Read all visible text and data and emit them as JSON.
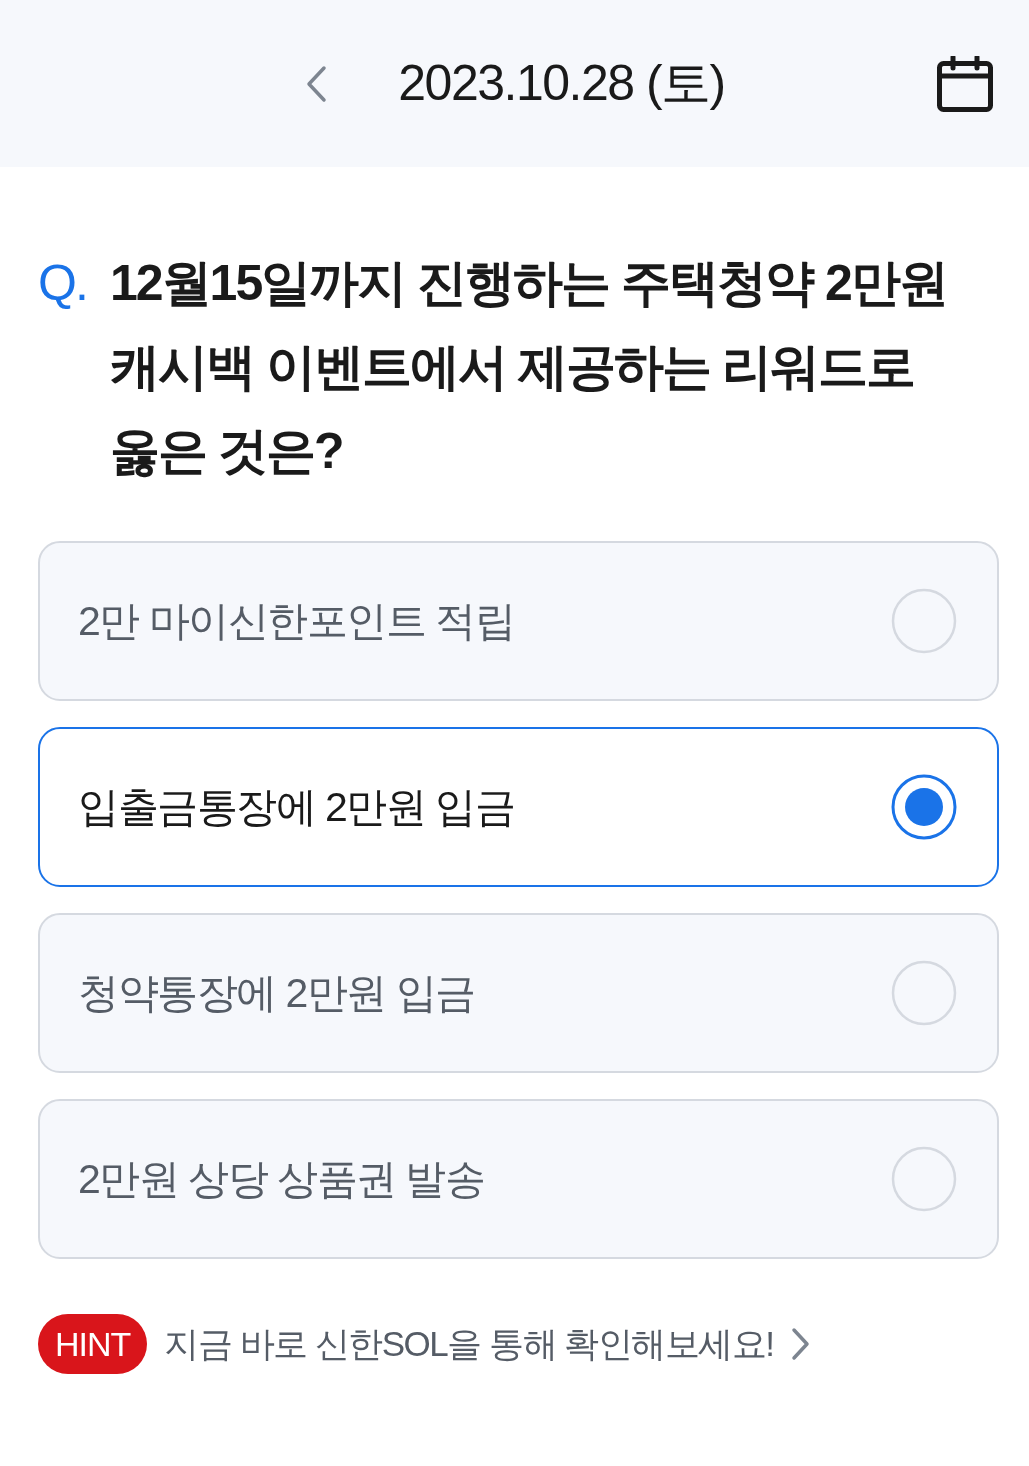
{
  "header": {
    "date": "2023.10.28 (토)"
  },
  "question": {
    "marker": "Q.",
    "text": "12월15일까지 진행하는 주택청약 2만원 캐시백 이벤트에서 제공하는 리워드로 옳은 것은?"
  },
  "options": [
    {
      "label": "2만 마이신한포인트 적립",
      "selected": false
    },
    {
      "label": "입출금통장에 2만원 입금",
      "selected": true
    },
    {
      "label": "청약통장에 2만원 입금",
      "selected": false
    },
    {
      "label": "2만원 상당 상품권 발송",
      "selected": false
    }
  ],
  "hint": {
    "badge": "HINT",
    "text": "지금 바로 신한SOL을 통해 확인해보세요!"
  }
}
